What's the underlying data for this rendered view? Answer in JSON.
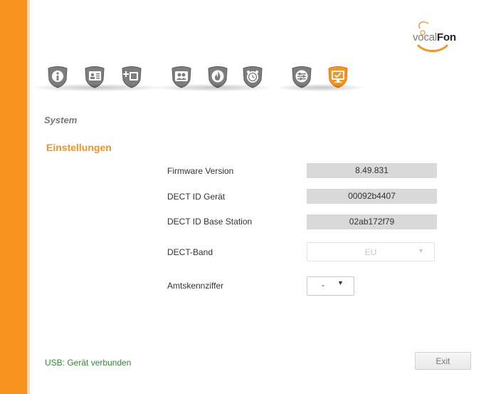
{
  "logo": {
    "part1": "vocal",
    "part2": "Fon",
    "accent_color": "#f7931e"
  },
  "nav": {
    "items": [
      {
        "icon": "info-icon",
        "active": false
      },
      {
        "icon": "contact-card-icon",
        "active": false
      },
      {
        "icon": "add-phone-icon",
        "active": false
      },
      {
        "icon": "users-icon",
        "active": false
      },
      {
        "icon": "flame-icon",
        "active": false
      },
      {
        "icon": "alarm-clock-icon",
        "active": false
      },
      {
        "icon": "sliders-icon",
        "active": false
      },
      {
        "icon": "monitor-check-icon",
        "active": true
      }
    ]
  },
  "page": {
    "section_title": "System",
    "subsection_title": "Einstellungen"
  },
  "fields": {
    "firmware": {
      "label": "Firmware Version",
      "value": "8.49.831"
    },
    "dect_id_device": {
      "label": "DECT ID Gerät",
      "value": "00092b4407"
    },
    "dect_id_base": {
      "label": "DECT ID Base Station",
      "value": "02ab172f79"
    },
    "dect_band": {
      "label": "DECT-Band",
      "value": "EU"
    },
    "amtskennziffer": {
      "label": "Amtskennziffer",
      "value": "-"
    }
  },
  "status": {
    "usb": "USB: Gerät verbunden",
    "color": "#2e8b2e"
  },
  "buttons": {
    "exit": "Exit"
  },
  "colors": {
    "accent": "#f7931e",
    "icon_gray": "#7d7d7d"
  }
}
